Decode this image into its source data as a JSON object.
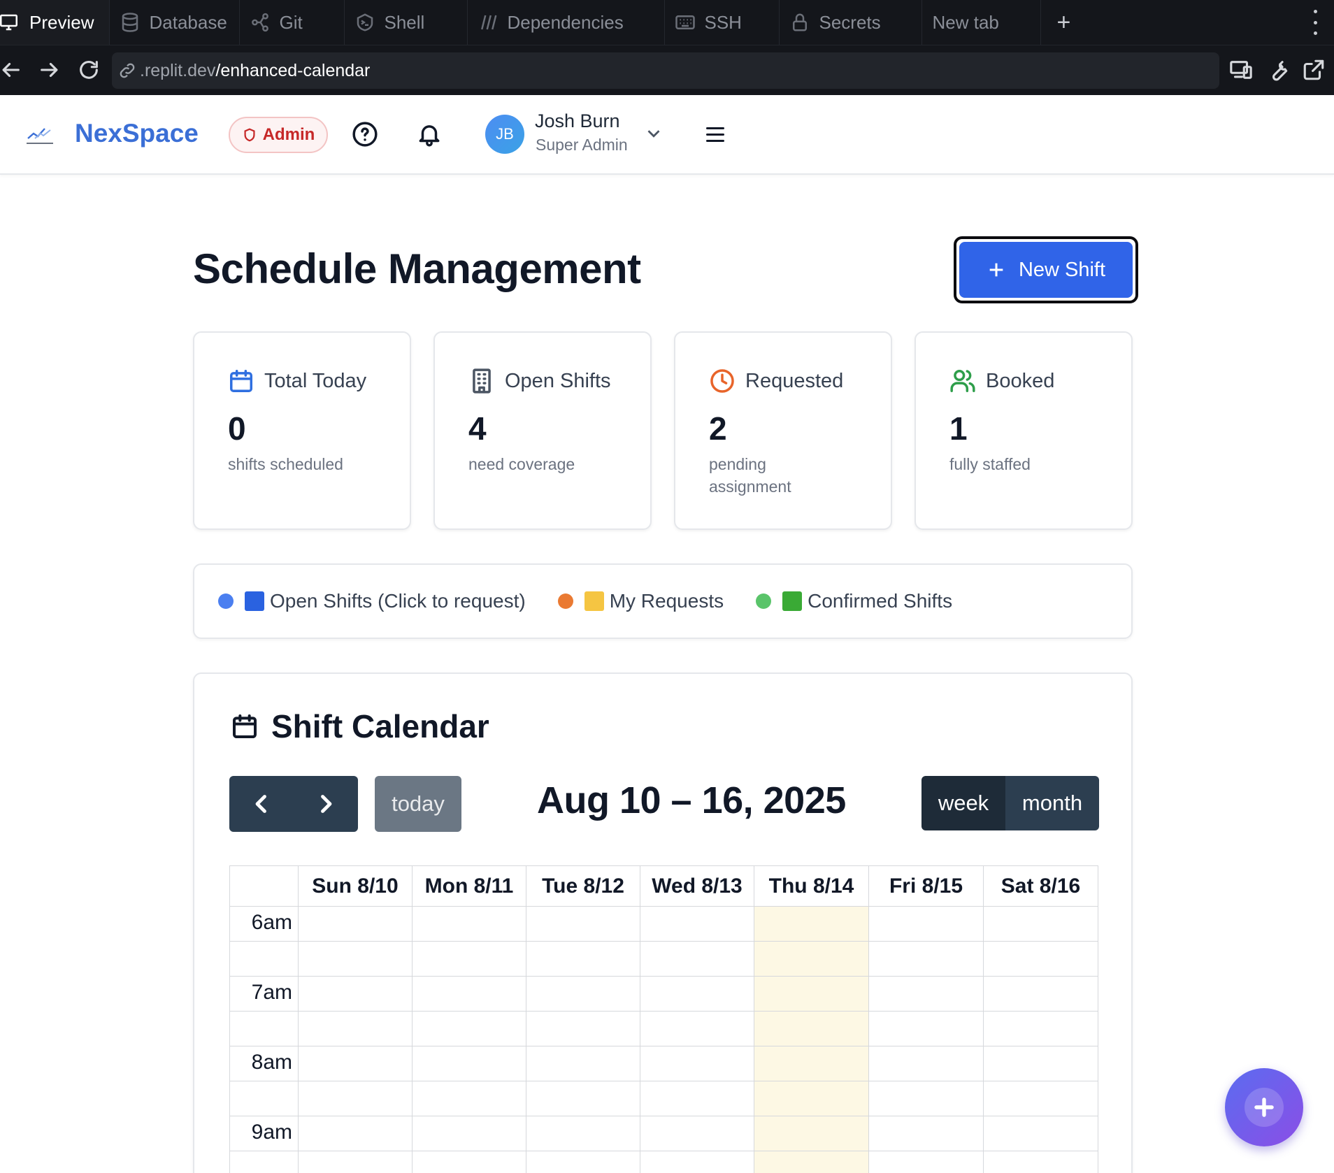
{
  "browser": {
    "tabs": [
      {
        "label": "Preview",
        "icon": "monitor-icon",
        "active": true
      },
      {
        "label": "Database",
        "icon": "database-icon"
      },
      {
        "label": "Git",
        "icon": "git-icon"
      },
      {
        "label": "Shell",
        "icon": "shell-icon"
      },
      {
        "label": "Dependencies",
        "icon": "dependencies-icon"
      },
      {
        "label": "SSH",
        "icon": "keyboard-icon"
      },
      {
        "label": "Secrets",
        "icon": "lock-icon"
      },
      {
        "label": "New tab",
        "icon": ""
      }
    ],
    "new_tab_symbol": "+",
    "url_domain": ".replit.dev",
    "url_path": "/enhanced-calendar"
  },
  "header": {
    "brand": "NexSpace",
    "admin_label": "Admin",
    "user_initials": "JB",
    "user_name": "Josh Burn",
    "user_role": "Super Admin"
  },
  "page": {
    "title": "Schedule Management",
    "new_shift_label": "New Shift"
  },
  "stats": [
    {
      "label": "Total Today",
      "value": "0",
      "sub": "shifts scheduled",
      "icon": "calendar-icon",
      "color": "#2f6fe0"
    },
    {
      "label": "Open Shifts",
      "value": "4",
      "sub": "need coverage",
      "icon": "building-icon",
      "color": "#4b5563"
    },
    {
      "label": "Requested",
      "value": "2",
      "sub": "pending assignment",
      "icon": "clock-icon",
      "color": "#e8642a"
    },
    {
      "label": "Booked",
      "value": "1",
      "sub": "fully staffed",
      "icon": "users-icon",
      "color": "#2e9e4a"
    }
  ],
  "legend": [
    {
      "label": "Open Shifts (Click to request)",
      "dot": "#4b7ff0",
      "square": "#2a62e0"
    },
    {
      "label": "My Requests",
      "dot": "#ea7a32",
      "square": "#f5c542"
    },
    {
      "label": "Confirmed Shifts",
      "dot": "#5ac46a",
      "square": "#3aaa35"
    }
  ],
  "calendar": {
    "title": "Shift Calendar",
    "today_label": "today",
    "range": "Aug 10 – 16, 2025",
    "view_week": "week",
    "view_month": "month",
    "days": [
      "Sun 8/10",
      "Mon 8/11",
      "Tue 8/12",
      "Wed 8/13",
      "Thu 8/14",
      "Fri 8/15",
      "Sat 8/16"
    ],
    "today_index": 4,
    "times": [
      "6am",
      "7am",
      "8am",
      "9am"
    ]
  }
}
